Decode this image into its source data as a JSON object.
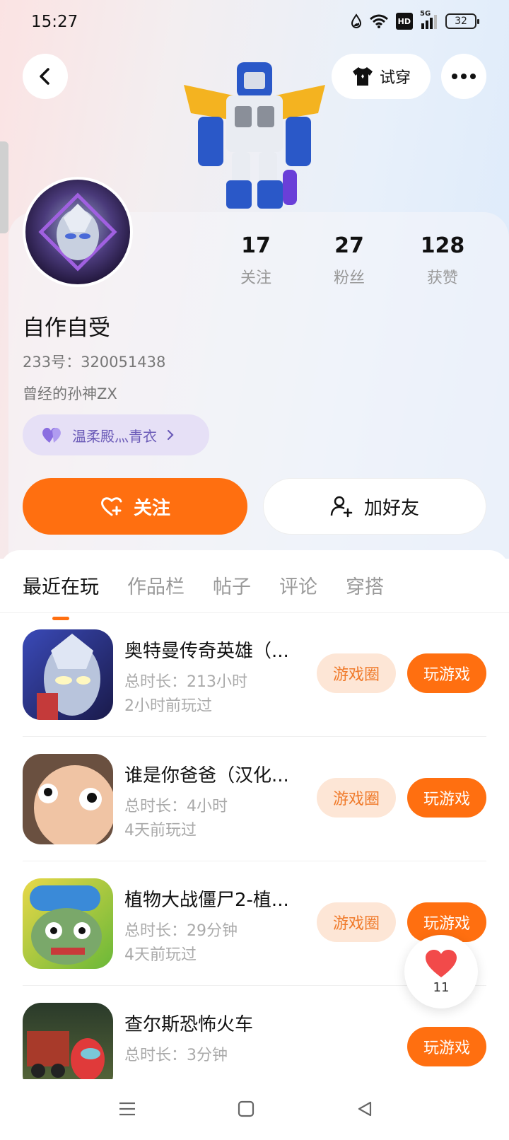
{
  "status_bar": {
    "time": "15:27",
    "battery": "32",
    "hd": "HD",
    "network": "5G"
  },
  "header": {
    "tryon_label": "试穿"
  },
  "profile": {
    "stats": [
      {
        "value": "17",
        "label": "关注"
      },
      {
        "value": "27",
        "label": "粉丝"
      },
      {
        "value": "128",
        "label": "获赞"
      }
    ],
    "username": "自作自受",
    "id_line": "233号：320051438",
    "bio": "曾经的孙神ZX",
    "relation": "温柔殿灬青衣",
    "follow_label": "关注",
    "add_friend_label": "加好友"
  },
  "tabs": [
    {
      "label": "最近在玩",
      "active": true
    },
    {
      "label": "作品栏",
      "active": false
    },
    {
      "label": "帖子",
      "active": false
    },
    {
      "label": "评论",
      "active": false
    },
    {
      "label": "穿搭",
      "active": false
    }
  ],
  "games": [
    {
      "title": "奥特曼传奇英雄（...",
      "duration": "总时长：213小时",
      "last_played": "2小时前玩过",
      "circle_label": "游戏圈",
      "play_label": "玩游戏"
    },
    {
      "title": "谁是你爸爸（汉化...",
      "duration": "总时长：4小时",
      "last_played": "4天前玩过",
      "circle_label": "游戏圈",
      "play_label": "玩游戏"
    },
    {
      "title": "植物大战僵尸2-植...",
      "duration": "总时长：29分钟",
      "last_played": "4天前玩过",
      "circle_label": "游戏圈",
      "play_label": "玩游戏"
    },
    {
      "title": "查尔斯恐怖火车",
      "duration": "总时长：3分钟",
      "last_played": "",
      "circle_label": "",
      "play_label": "玩游戏"
    }
  ],
  "float_like": {
    "count": "11"
  },
  "colors": {
    "accent": "#ff6f10",
    "accent_soft": "#fde6d6",
    "relation_bg": "#e6e0f6",
    "relation_text": "#6b5bb8"
  },
  "icons": [
    "back-arrow-icon",
    "tshirt-icon",
    "more-dots-icon",
    "heart-plus-icon",
    "add-user-icon",
    "heart-icon",
    "chevron-right-icon",
    "purple-heart-icon"
  ]
}
